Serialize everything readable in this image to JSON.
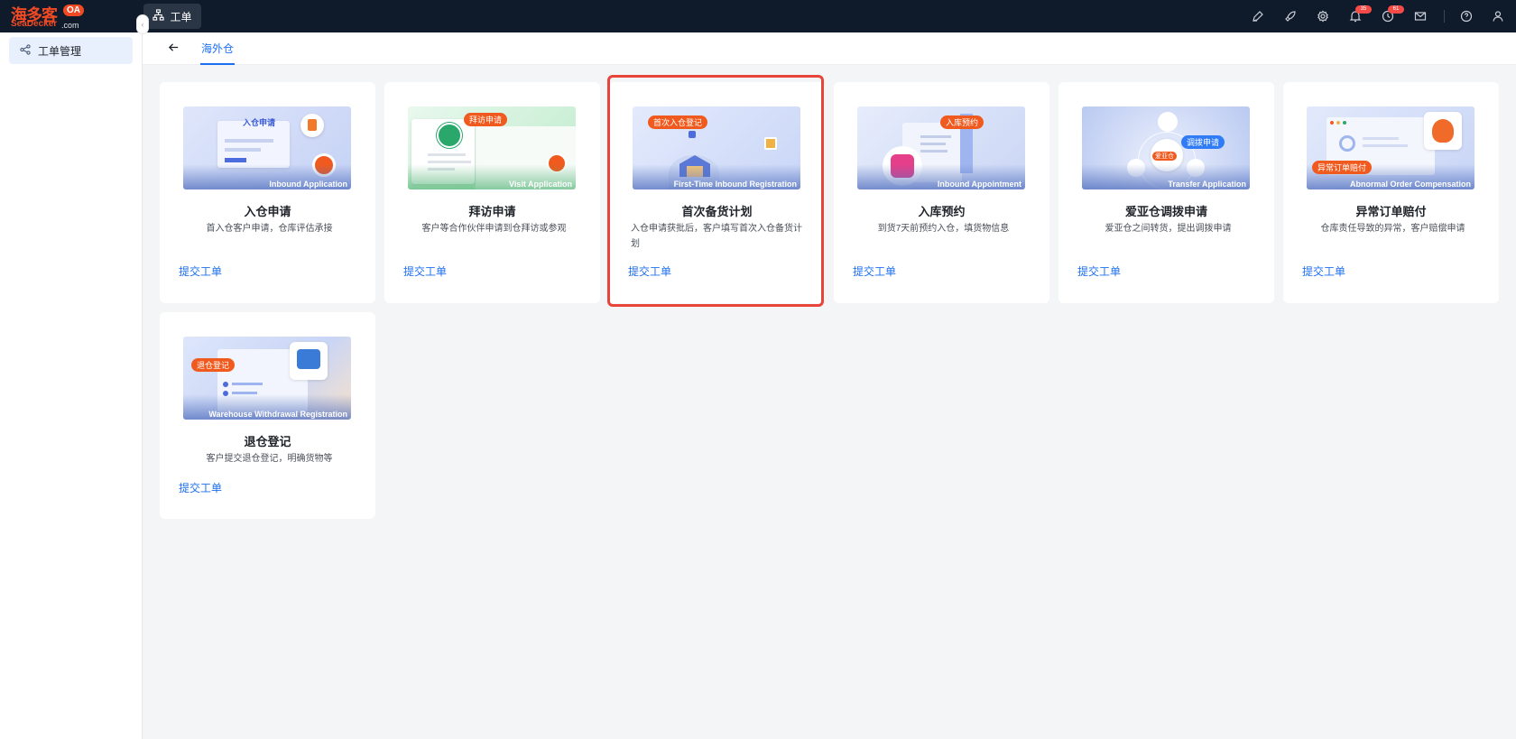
{
  "app": {
    "logo_cn": "海多客",
    "logo_oa": "OA",
    "logo_en": "SeaDecker",
    "logo_com": ".com",
    "top_tab_label": "工单",
    "notification_count": "35",
    "reminder_count": "61"
  },
  "icons": {
    "top_tab": "sitemap-icon",
    "toolbar": [
      "pen-icon",
      "rocket-icon",
      "gear-icon",
      "bell-icon",
      "clock-icon",
      "mail-icon",
      "help-icon",
      "user-icon"
    ]
  },
  "colors": {
    "topbar": "#0f1a2b",
    "accent": "#1d6ff2",
    "brand": "#f04a24",
    "highlight": "#e8443a"
  },
  "sidebar": {
    "items": [
      {
        "label": "工单管理",
        "icon": "flow-icon"
      }
    ]
  },
  "subheader": {
    "tab_label": "海外仓"
  },
  "cards": [
    {
      "title": "入仓申请",
      "desc": "首入仓客户申请，仓库评估承接",
      "image_caption": "Inbound Application",
      "image_tag": "入仓申请",
      "submit": "提交工单"
    },
    {
      "title": "拜访申请",
      "desc": "客户等合作伙伴申请到仓拜访或参观",
      "image_caption": "Visit Application",
      "image_tag": "拜访申请",
      "submit": "提交工单"
    },
    {
      "title": "首次备货计划",
      "desc": "入仓申请获批后，客户填写首次入仓备货计划",
      "image_caption": "First-Time Inbound Registration",
      "image_tag": "首次入仓登记",
      "submit": "提交工单",
      "highlighted": true
    },
    {
      "title": "入库预约",
      "desc": "到货7天前预约入仓，填货物信息",
      "image_caption": "Inbound Appointment",
      "image_tag": "入库预约",
      "submit": "提交工单"
    },
    {
      "title": "爱亚仓调拨申请",
      "desc": "爱亚仓之间转货，提出调拨申请",
      "image_caption": "Transfer Application",
      "image_tag": "调拨申请",
      "image_tag2": "爱亚仓",
      "submit": "提交工单"
    },
    {
      "title": "异常订单赔付",
      "desc": "仓库责任导致的异常，客户赔偿申请",
      "image_caption": "Abnormal Order Compensation",
      "image_tag": "异常订单赔付",
      "submit": "提交工单"
    },
    {
      "title": "退仓登记",
      "desc": "客户提交退仓登记，明确货物等",
      "image_caption": "Warehouse Withdrawal Registration",
      "image_tag": "退仓登记",
      "submit": "提交工单"
    }
  ]
}
